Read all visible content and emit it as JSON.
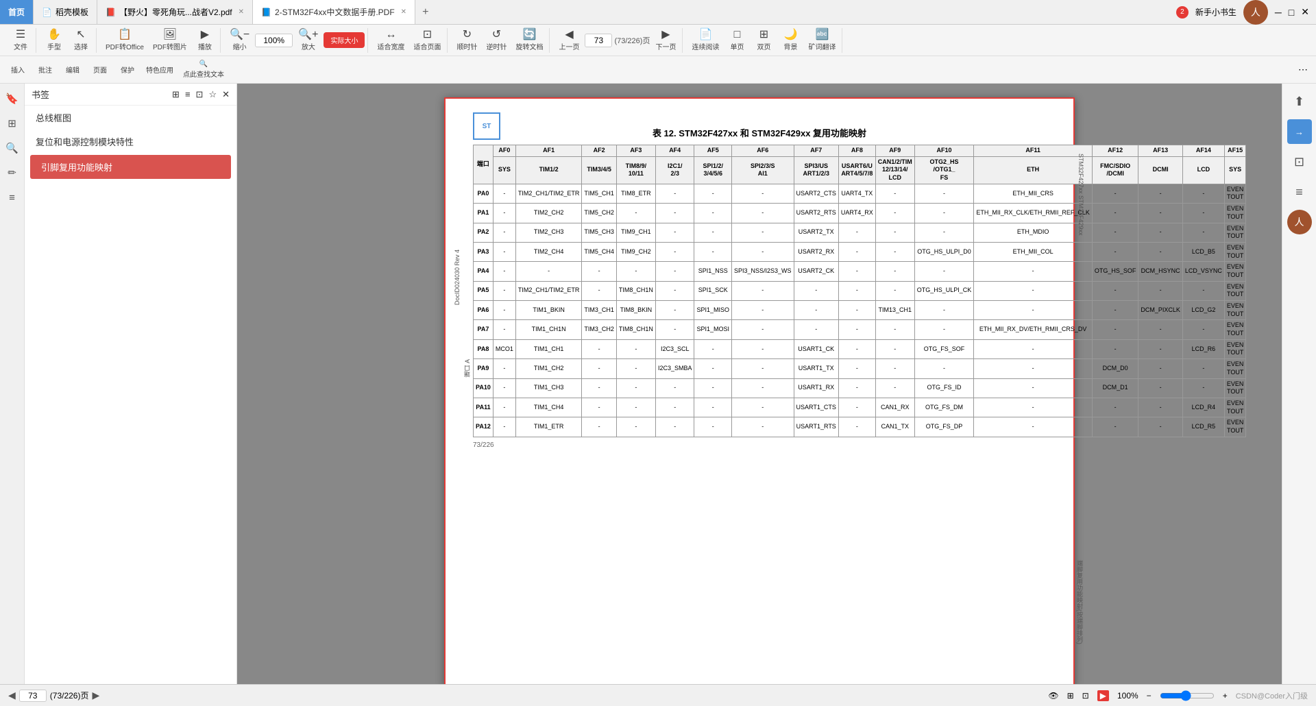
{
  "tabs": [
    {
      "id": "home",
      "label": "首页",
      "active": false,
      "closable": false
    },
    {
      "id": "template",
      "label": "稻壳模板",
      "active": false,
      "closable": false
    },
    {
      "id": "wildfire",
      "label": "【野火】零死角玩...战者V2.pdf",
      "active": false,
      "closable": true
    },
    {
      "id": "stm32",
      "label": "2-STM32F4xx中文数据手册.PDF",
      "active": true,
      "closable": true
    }
  ],
  "toolbar": {
    "file_label": "文件",
    "hand_label": "手型",
    "select_label": "选择",
    "pdf_office": "PDF转Office",
    "pdf_image": "PDF转图片",
    "play": "播放",
    "zoom_out": "缩小",
    "zoom_value": "100%",
    "zoom_in": "放大",
    "actual_size": "实际大小",
    "fit_width": "适合宽度",
    "fit_page": "适合页面",
    "clockwise": "顺时针",
    "counterclockwise": "逆时针",
    "rotate_doc": "旋转文档",
    "prev_page": "上一页",
    "page_num": "73",
    "page_total": "(73/226)页",
    "next_page": "下一页",
    "continuous": "连续阅读",
    "single_page": "单页",
    "double_page": "双页",
    "background": "背景",
    "translate": "矿词翻译",
    "insert": "插入",
    "annotate": "批注",
    "edit": "编辑",
    "page_menu": "页面",
    "protect": "保护",
    "special_app": "特色应用",
    "find": "点此查找文本"
  },
  "sidebar": {
    "title": "书签",
    "items": [
      {
        "label": "总线框图",
        "active": false
      },
      {
        "label": "复位和电源控制模块特性",
        "active": false
      },
      {
        "label": "引脚复用功能映射",
        "active": true
      }
    ]
  },
  "pdf": {
    "title": "表 12. STM32F427xx 和 STM32F429xx 复用功能映射",
    "col_headers": [
      "AF0",
      "AF1",
      "AF2",
      "AF3",
      "AF4",
      "AF5",
      "AF6",
      "AF7",
      "AF8",
      "AF9",
      "AF10",
      "AF11",
      "AF12",
      "AF13",
      "AF14",
      "AF15"
    ],
    "sub_headers": {
      "AF0": "SYS",
      "AF1": "TIM1/2",
      "AF2": "TIM3/4/5",
      "AF3": "TIM8/9/10/11",
      "AF4": "I2C1/2/3",
      "AF5": "SPI1/2/3/4/5/6",
      "AF6": "SPI2/3/SAI1",
      "AF7": "SPI3/USART1/2/3",
      "AF8": "USART6/UART4/5/7/8",
      "AF9": "CAN1/2/TIM12/13/14/LCD",
      "AF10": "OTG2_HS/OTG1_FS",
      "AF11": "ETH",
      "AF12": "FMC/SDIO/DCMI",
      "AF13": "DCMI",
      "AF14": "LCD",
      "AF15": "SYS"
    },
    "rows": [
      {
        "pin": "PA0",
        "af0": "-",
        "af1": "TIM2_CH1/TIM2_ETR",
        "af2": "TIM5_CH1",
        "af3": "TIM8_ETR",
        "af4": "-",
        "af5": "-",
        "af6": "-",
        "af7": "USART2_CTS",
        "af8": "UART4_TX",
        "af9": "-",
        "af10": "-",
        "af11": "ETH_MII_CRS",
        "af12": "-",
        "af13": "-",
        "af14": "-",
        "af15": "EVEN TOUT"
      },
      {
        "pin": "PA1",
        "af0": "-",
        "af1": "TIM2_CH2",
        "af2": "TIM5_CH2",
        "af3": "-",
        "af4": "-",
        "af5": "-",
        "af6": "-",
        "af7": "USART2_RTS",
        "af8": "UART4_RX",
        "af9": "-",
        "af10": "-",
        "af11": "ETH_MII_RX_CLK/ETH_RMII_REF_CLK",
        "af12": "-",
        "af13": "-",
        "af14": "-",
        "af15": "EVEN TOUT"
      },
      {
        "pin": "PA2",
        "af0": "-",
        "af1": "TIM2_CH3",
        "af2": "TIM5_CH3",
        "af3": "TIM9_CH1",
        "af4": "-",
        "af5": "-",
        "af6": "-",
        "af7": "USART2_TX",
        "af8": "-",
        "af9": "-",
        "af10": "-",
        "af11": "ETH_MDIO",
        "af12": "-",
        "af13": "-",
        "af14": "-",
        "af15": "EVEN TOUT"
      },
      {
        "pin": "PA3",
        "af0": "-",
        "af1": "TIM2_CH4",
        "af2": "TIM5_CH4",
        "af3": "TIM9_CH2",
        "af4": "-",
        "af5": "-",
        "af6": "-",
        "af7": "USART2_RX",
        "af8": "-",
        "af9": "-",
        "af10": "OTG_HS_ULPI_D0",
        "af11": "ETH_MII_COL",
        "af12": "-",
        "af13": "-",
        "af14": "LCD_B5",
        "af15": "EVEN TOUT"
      },
      {
        "pin": "PA4",
        "af0": "-",
        "af1": "-",
        "af2": "-",
        "af3": "-",
        "af4": "-",
        "af5": "SPI1_NSS",
        "af6": "SPI3_NSS/I2S3_WS",
        "af7": "USART2_CK",
        "af8": "-",
        "af9": "-",
        "af10": "-",
        "af11": "-",
        "af12": "OTG_HS_SOF",
        "af13": "DCM_HSYNC",
        "af14": "LCD_VSYNC",
        "af15": "EVEN TOUT"
      },
      {
        "pin": "PA5",
        "af0": "-",
        "af1": "TIM2_CH1/TIM2_ETR",
        "af2": "-",
        "af3": "TIM8_CH1N",
        "af4": "-",
        "af5": "SPI1_SCK",
        "af6": "-",
        "af7": "-",
        "af8": "-",
        "af9": "-",
        "af10": "OTG_HS_ULPI_CK",
        "af11": "-",
        "af12": "-",
        "af13": "-",
        "af14": "-",
        "af15": "EVEN TOUT"
      },
      {
        "pin": "PA6",
        "af0": "-",
        "af1": "TIM1_BKIN",
        "af2": "TIM3_CH1",
        "af3": "TIM8_BKIN",
        "af4": "-",
        "af5": "SPI1_MISO",
        "af6": "-",
        "af7": "-",
        "af8": "-",
        "af9": "TIM13_CH1",
        "af10": "-",
        "af11": "-",
        "af12": "-",
        "af13": "DCM_PIXCLK",
        "af14": "LCD_G2",
        "af15": "EVEN TOUT"
      },
      {
        "pin": "PA7",
        "af0": "-",
        "af1": "TIM1_CH1N",
        "af2": "TIM3_CH2",
        "af3": "TIM8_CH1N",
        "af4": "-",
        "af5": "SPI1_MOSI",
        "af6": "-",
        "af7": "-",
        "af8": "-",
        "af9": "-",
        "af10": "-",
        "af11": "ETH_MII_RX_DV/ETH_RMII_CRS_DV",
        "af12": "-",
        "af13": "-",
        "af14": "-",
        "af15": "EVEN TOUT"
      },
      {
        "pin": "PA8",
        "af0": "MCO1",
        "af1": "TIM1_CH1",
        "af2": "-",
        "af3": "-",
        "af4": "I2C3_SCL",
        "af5": "-",
        "af6": "-",
        "af7": "USART1_CK",
        "af8": "-",
        "af9": "-",
        "af10": "OTG_FS_SOF",
        "af11": "-",
        "af12": "-",
        "af13": "-",
        "af14": "LCD_R6",
        "af15": "EVEN TOUT"
      },
      {
        "pin": "PA9",
        "af0": "-",
        "af1": "TIM1_CH2",
        "af2": "-",
        "af3": "-",
        "af4": "I2C3_SMBA",
        "af5": "-",
        "af6": "-",
        "af7": "USART1_TX",
        "af8": "-",
        "af9": "-",
        "af10": "-",
        "af11": "-",
        "af12": "DCM_D0",
        "af13": "-",
        "af14": "-",
        "af15": "EVEN TOUT"
      },
      {
        "pin": "PA10",
        "af0": "-",
        "af1": "TIM1_CH3",
        "af2": "-",
        "af3": "-",
        "af4": "-",
        "af5": "-",
        "af6": "-",
        "af7": "USART1_RX",
        "af8": "-",
        "af9": "-",
        "af10": "OTG_FS_ID",
        "af11": "-",
        "af12": "DCM_D1",
        "af13": "-",
        "af14": "-",
        "af15": "EVEN TOUT"
      },
      {
        "pin": "PA11",
        "af0": "-",
        "af1": "TIM1_CH4",
        "af2": "-",
        "af3": "-",
        "af4": "-",
        "af5": "-",
        "af6": "-",
        "af7": "USART1_CTS",
        "af8": "-",
        "af9": "CAN1_RX",
        "af10": "OTG_FS_DM",
        "af11": "-",
        "af12": "-",
        "af13": "-",
        "af14": "LCD_R4",
        "af15": "EVEN TOUT"
      },
      {
        "pin": "PA12",
        "af0": "-",
        "af1": "TIM1_ETR",
        "af2": "-",
        "af3": "-",
        "af4": "-",
        "af5": "-",
        "af6": "-",
        "af7": "USART1_RTS",
        "af8": "-",
        "af9": "CAN1_TX",
        "af10": "OTG_FS_DP",
        "af11": "-",
        "af12": "-",
        "af13": "-",
        "af14": "LCD_R5",
        "af15": "EVEN TOUT"
      }
    ],
    "port_a_label": "端口 A",
    "doc_label": "DocID024030 Rev 4",
    "page_bottom": "73/226",
    "right_text": "STM32F427xx STM32F429xx",
    "bottom_right_text": "端脚复用功能映射(按端脚排列)"
  },
  "statusbar": {
    "page_current": "73",
    "page_info": "(73/226)页",
    "zoom": "100%",
    "watermark": "CSDN@Coder入门级"
  }
}
